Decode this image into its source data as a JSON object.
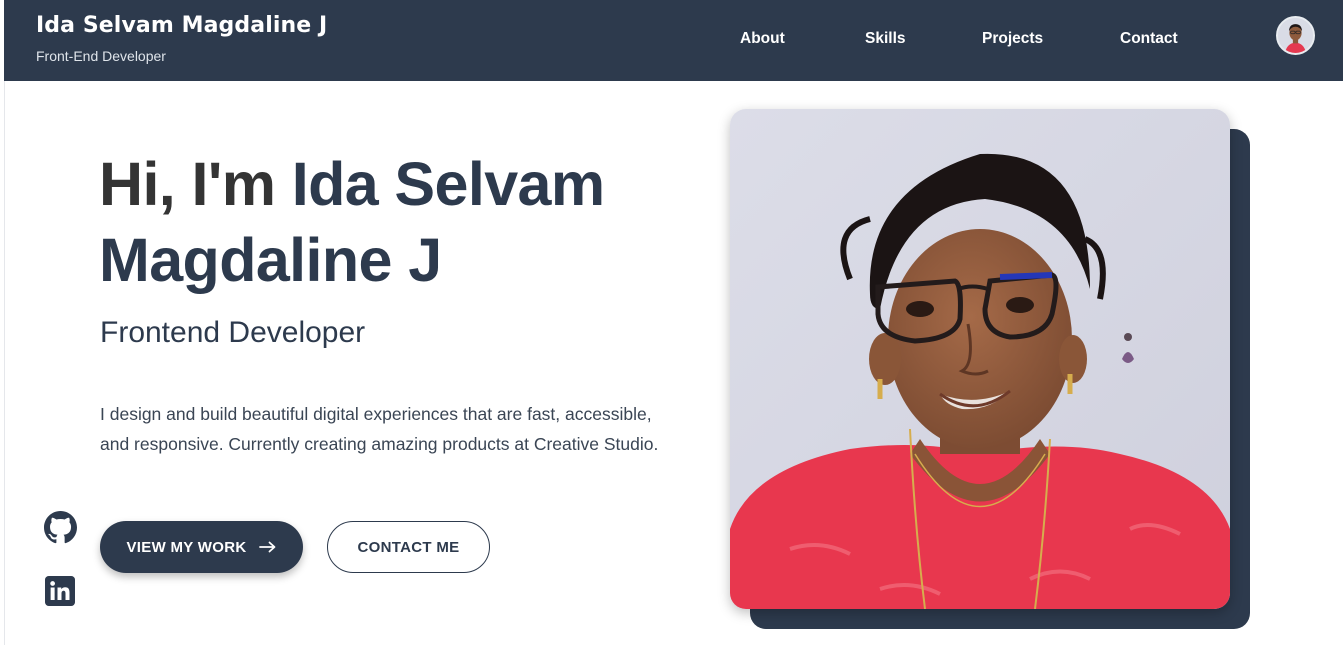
{
  "header": {
    "name": "Ida Selvam Magdaline J",
    "subtitle": "Front-End Developer",
    "nav": [
      {
        "label": "About"
      },
      {
        "label": "Skills"
      },
      {
        "label": "Projects"
      },
      {
        "label": "Contact"
      }
    ]
  },
  "hero": {
    "greeting": "Hi, I'm ",
    "name": "Ida Selvam Magdaline J",
    "role": "Frontend Developer",
    "description": "I design and build beautiful digital experiences that are fast, accessible, and responsive. Currently creating amazing products at Creative Studio.",
    "primary_button": "VIEW MY WORK",
    "primary_button_icon": "arrow-right-icon",
    "secondary_button": "CONTACT ME"
  },
  "social": [
    {
      "icon": "github-icon"
    },
    {
      "icon": "linkedin-icon"
    }
  ],
  "colors": {
    "primary": "#2d3a4d",
    "background": "#ffffff",
    "text_dark": "#343434"
  }
}
